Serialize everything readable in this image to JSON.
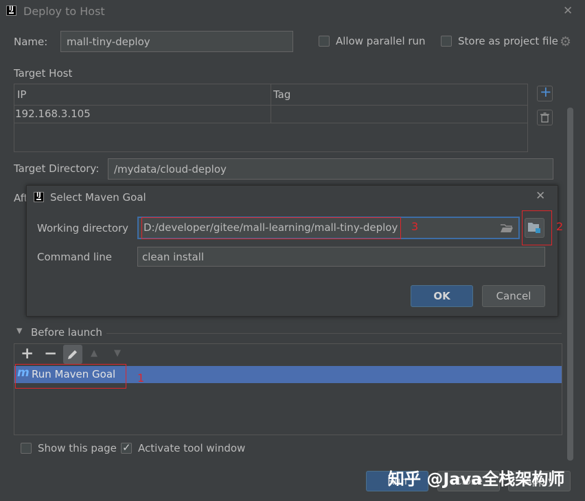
{
  "window": {
    "title": "Deploy to Host",
    "app_icon": "intellij-icon",
    "close_icon": "close-icon"
  },
  "config": {
    "name_label": "Name:",
    "name_value": "mall-tiny-deploy",
    "allow_parallel_label": "Allow parallel run",
    "allow_parallel_checked": false,
    "store_project_label": "Store as project file",
    "store_project_checked": false,
    "settings_icon": "gear-icon"
  },
  "target_host": {
    "label": "Target Host",
    "columns": [
      "IP",
      "Tag"
    ],
    "rows": [
      {
        "ip": "192.168.3.105",
        "tag": ""
      }
    ],
    "add_icon": "plus-icon",
    "delete_icon": "trash-icon"
  },
  "target_directory": {
    "label": "Target Directory:",
    "value": "/mydata/cloud-deploy"
  },
  "after_label_fragment": "Aft",
  "maven_dialog": {
    "title": "Select Maven Goal",
    "working_dir_label": "Working directory",
    "working_dir_value": "D:/developer/gitee/mall-learning/mall-tiny-deploy",
    "command_line_label": "Command line",
    "command_line_value": "clean install",
    "ok_label": "OK",
    "cancel_label": "Cancel",
    "browse_icon": "folder-open-icon",
    "module_icon": "module-folder-icon",
    "close_icon": "close-icon"
  },
  "before_launch": {
    "label": "Before launch",
    "toolbar_icons": [
      "plus-icon",
      "minus-icon",
      "pencil-icon",
      "arrow-up-icon",
      "arrow-down-icon"
    ],
    "items": [
      {
        "label": "Run Maven Goal",
        "icon": "maven-icon"
      }
    ]
  },
  "footer": {
    "show_page_label": "Show this page",
    "show_page_checked": false,
    "activate_tool_label": "Activate tool window",
    "activate_tool_checked": true,
    "run_label": "Run",
    "close_label": "Close",
    "apply_label": "Apply"
  },
  "annotations": [
    "1",
    "2",
    "3"
  ],
  "watermark": "知乎 @Java全栈架构师",
  "colors": {
    "background": "#3c3f41",
    "selection": "#4b6eaf",
    "default_button": "#365880",
    "annotation_red": "#e0262a",
    "focus_border": "#3d6ea7"
  }
}
